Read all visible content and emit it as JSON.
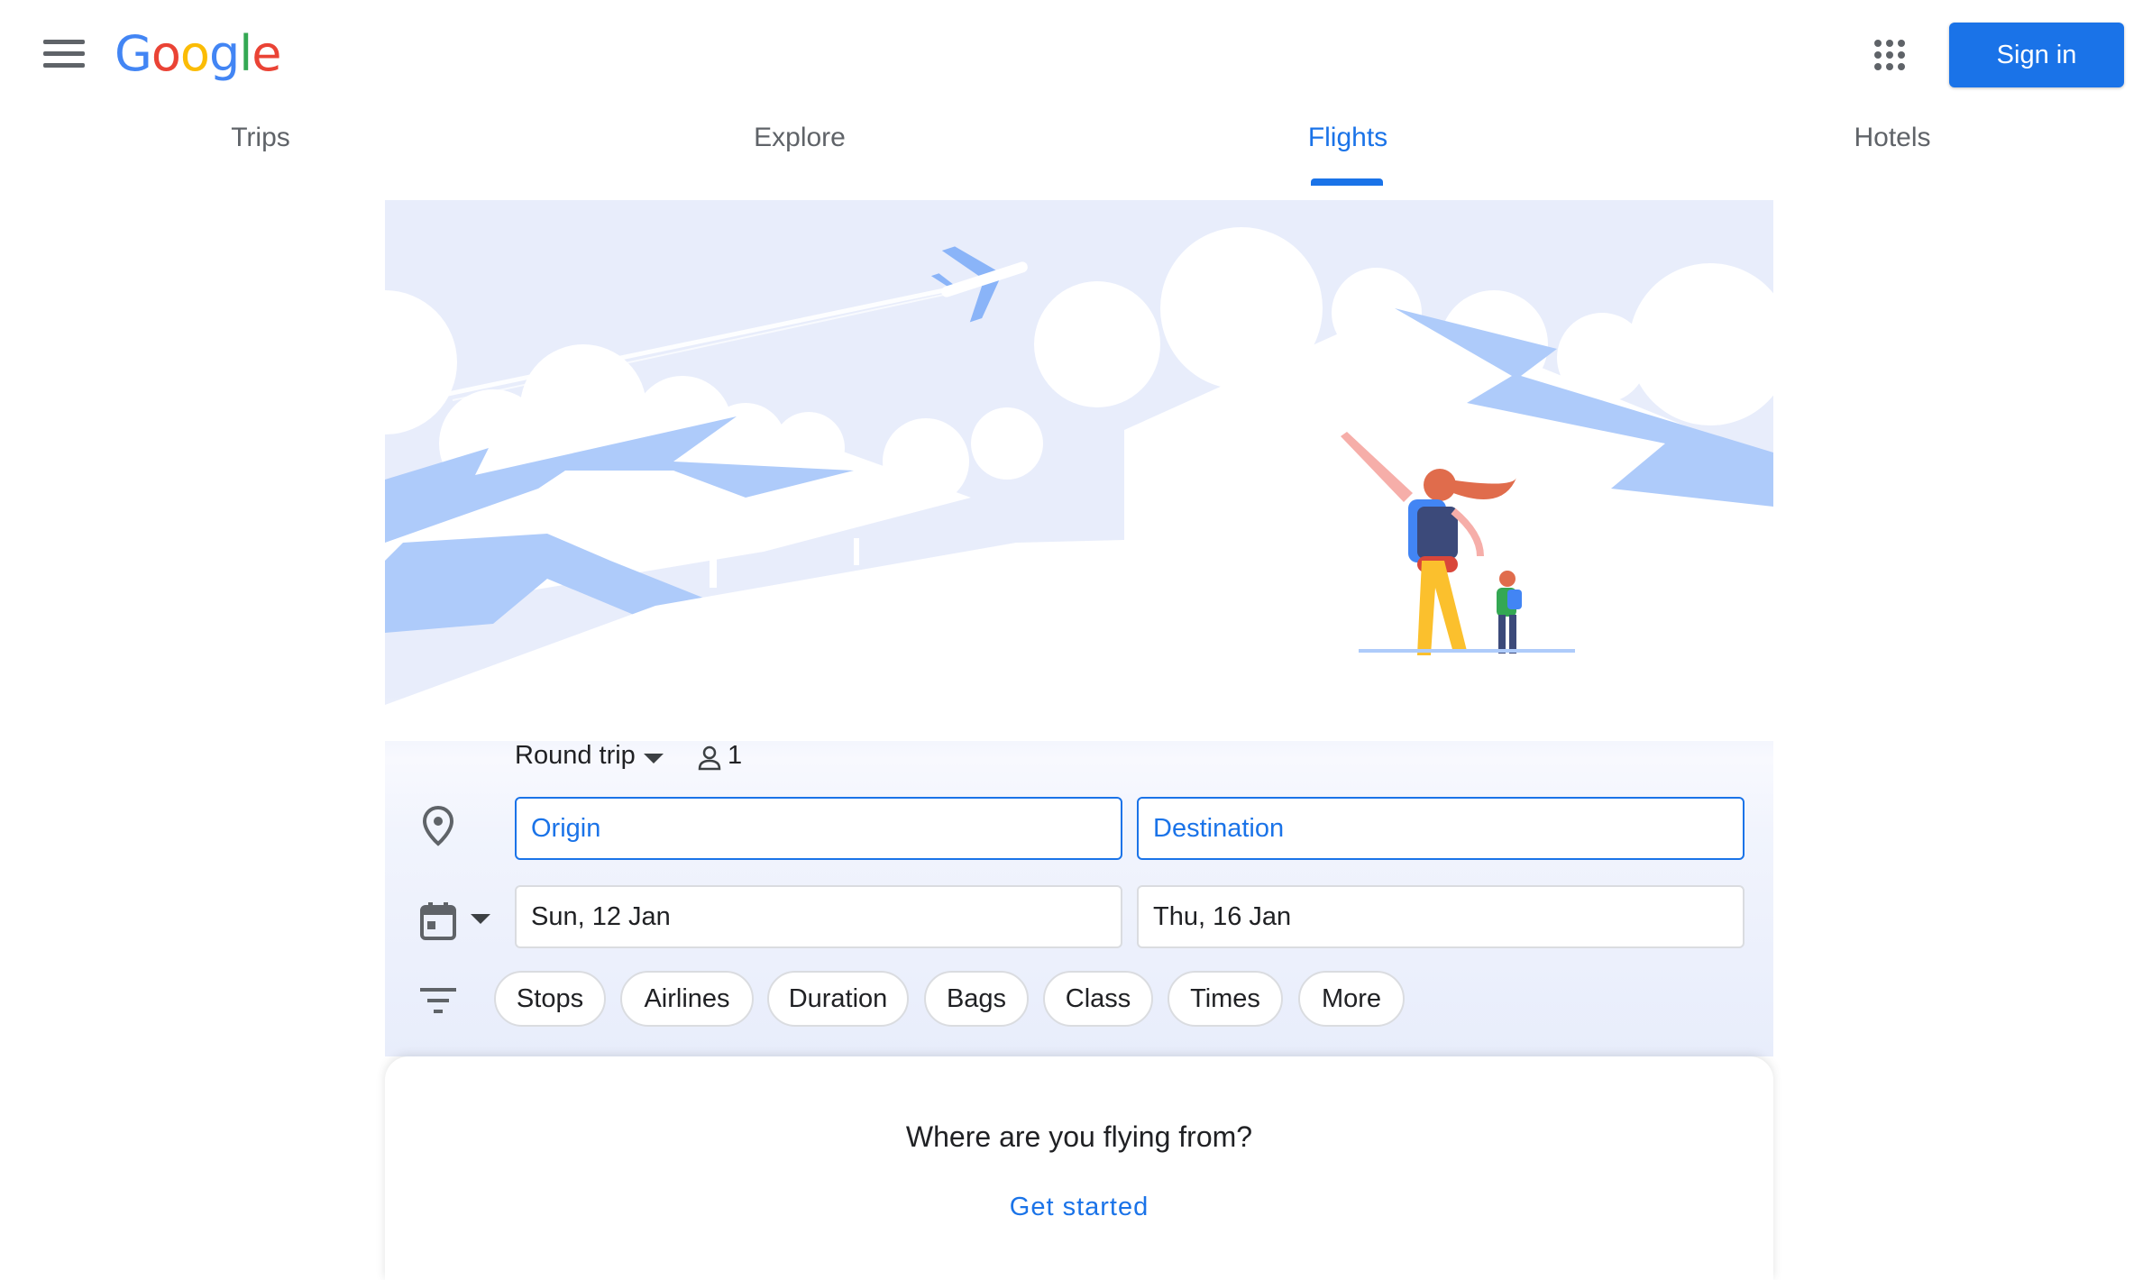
{
  "header": {
    "logo_text": "Google",
    "sign_in_label": "Sign in",
    "menu_icon": "hamburger-menu-icon",
    "apps_icon": "apps-grid-icon"
  },
  "tabs": [
    {
      "label": "Trips",
      "active": false
    },
    {
      "label": "Explore",
      "active": false
    },
    {
      "label": "Flights",
      "active": true
    },
    {
      "label": "Hotels",
      "active": false
    }
  ],
  "search": {
    "trip_type": "Round trip",
    "passengers": "1",
    "origin_placeholder": "Origin",
    "destination_placeholder": "Destination",
    "depart_date": "Sun, 12 Jan",
    "return_date": "Thu, 16 Jan"
  },
  "filters": [
    "Stops",
    "Airlines",
    "Duration",
    "Bags",
    "Class",
    "Times",
    "More"
  ],
  "prompt": {
    "question": "Where are you flying from?",
    "cta": "Get started"
  },
  "colors": {
    "accent": "#1a73e8",
    "hero_background": "#e8edfb",
    "mountain": "#aecbfa"
  }
}
